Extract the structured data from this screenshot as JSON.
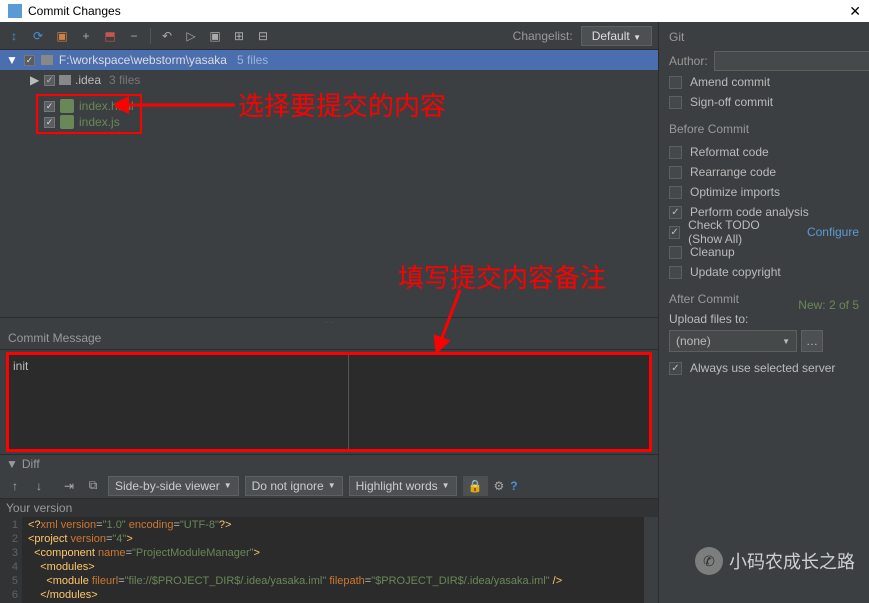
{
  "window": {
    "title": "Commit Changes"
  },
  "toolbar": {
    "changelist_label": "Changelist:",
    "changelist_value": "Default"
  },
  "tree": {
    "root_path": "F:\\workspace\\webstorm\\yasaka",
    "root_count": "5 files",
    "idea_folder": ".idea",
    "idea_count": "3 files",
    "files": [
      {
        "name": "index.html",
        "checked": true
      },
      {
        "name": "index.js",
        "checked": true
      }
    ],
    "new_label": "New: 2 of 5"
  },
  "annotations": {
    "select_files": "选择要提交的内容",
    "commit_note": "填写提交内容备注"
  },
  "commit_message": {
    "label": "Commit Message",
    "value": "init"
  },
  "diff": {
    "label": "Diff",
    "viewer": "Side-by-side viewer",
    "ignore": "Do not ignore",
    "highlight": "Highlight words",
    "your_version": "Your version"
  },
  "code": {
    "lines": [
      "<?xml version=\"1.0\" encoding=\"UTF-8\"?>",
      "<project version=\"4\">",
      "  <component name=\"ProjectModuleManager\">",
      "    <modules>",
      "      <module fileurl=\"file://$PROJECT_DIR$/.idea/yasaka.iml\" filepath=\"$PROJECT_DIR$/.idea/yasaka.iml\" />",
      "    </modules>"
    ]
  },
  "right": {
    "git": "Git",
    "author": "Author:",
    "amend": "Amend commit",
    "signoff": "Sign-off commit",
    "before": "Before Commit",
    "reformat": "Reformat code",
    "rearrange": "Rearrange code",
    "optimize": "Optimize imports",
    "analysis": "Perform code analysis",
    "todo": "Check TODO (Show All)",
    "configure": "Configure",
    "cleanup": "Cleanup",
    "copyright": "Update copyright",
    "after": "After Commit",
    "upload": "Upload files to:",
    "upload_value": "(none)",
    "always": "Always use selected server"
  },
  "watermark": {
    "text": "小码农成长之路"
  }
}
